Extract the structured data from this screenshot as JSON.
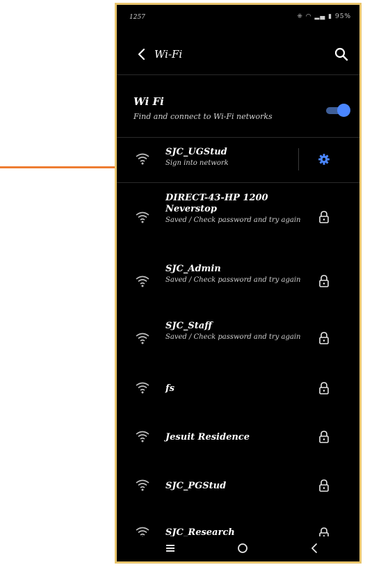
{
  "status_bar": {
    "time": "1257",
    "icons_text": "⁜ ◠ ▂▄ ▮ 95%"
  },
  "app_bar": {
    "title": "Wi-Fi"
  },
  "wifi_header": {
    "title": "Wi Fi",
    "subtitle": "Find and connect to Wi-Fi networks",
    "enabled": true
  },
  "colors": {
    "accent": "#4a86ff",
    "frame": "#e8c46c",
    "arrow": "#ee7d33",
    "background": "#000000"
  },
  "networks": [
    {
      "name": "SJC_UGStud",
      "status": "Sign into network",
      "icon": "gear-icon"
    },
    {
      "name": "DIRECT-43-HP 1200 Neverstop",
      "status": "Saved / Check password and try again",
      "icon": "lock-icon"
    },
    {
      "name": "SJC_Admin",
      "status": "Saved / Check password and try again",
      "icon": "lock-icon"
    },
    {
      "name": "SJC_Staff",
      "status": "Saved / Check password and try again",
      "icon": "lock-icon"
    },
    {
      "name": "fs",
      "status": "",
      "icon": "lock-icon"
    },
    {
      "name": "Jesuit Residence",
      "status": "",
      "icon": "lock-icon"
    },
    {
      "name": "SJC_PGStud",
      "status": "",
      "icon": "lock-icon"
    },
    {
      "name": "SJC_Research",
      "status": "",
      "icon": "lock-icon"
    }
  ]
}
